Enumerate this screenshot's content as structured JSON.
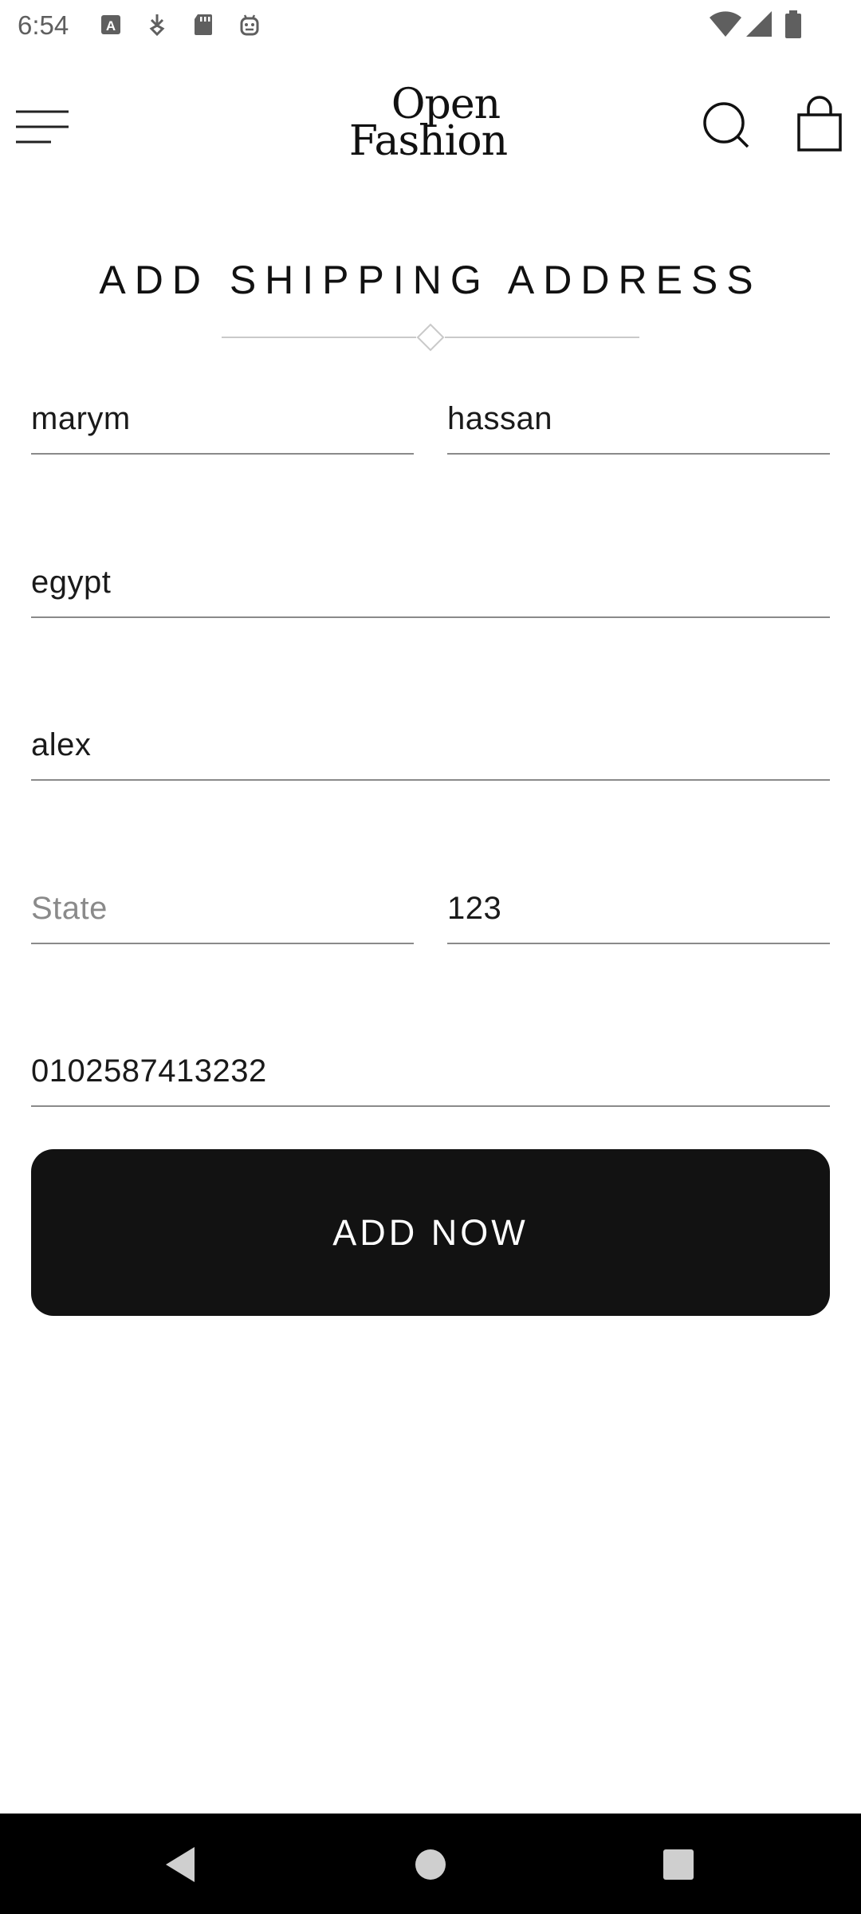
{
  "status_bar": {
    "time": "6:54"
  },
  "header": {
    "logo_line1": "Open",
    "logo_line2": "Fashion"
  },
  "page": {
    "title": "ADD SHIPPING ADDRESS"
  },
  "form": {
    "first_name": {
      "value": "marym",
      "placeholder": ""
    },
    "last_name": {
      "value": "hassan",
      "placeholder": ""
    },
    "country": {
      "value": "egypt",
      "placeholder": ""
    },
    "city": {
      "value": "alex",
      "placeholder": ""
    },
    "state": {
      "value": "",
      "placeholder": "State"
    },
    "zip": {
      "value": "123",
      "placeholder": ""
    },
    "phone": {
      "value": "0102587413232",
      "placeholder": ""
    }
  },
  "actions": {
    "add_label": "ADD NOW"
  },
  "icons": {
    "menu": "menu-icon",
    "search": "search-icon",
    "cart": "shopping-bag-icon",
    "back": "back-triangle-icon",
    "home": "home-circle-icon",
    "recents": "recents-square-icon"
  },
  "colors": {
    "button_bg": "#121212",
    "button_text": "#ffffff",
    "field_underline": "#8a8a8a",
    "placeholder": "#8a8a8a",
    "nav_bar": "#000000"
  }
}
